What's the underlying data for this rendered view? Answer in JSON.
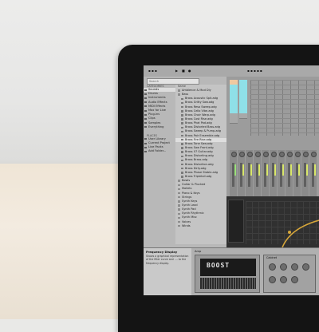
{
  "browser": {
    "search_placeholder": "Search",
    "categories_header": "CATEGORIES",
    "categories": [
      "Sounds",
      "Drums",
      "Instruments",
      "Audio Effects",
      "MIDI Effects",
      "Max for Live",
      "Plug-ins",
      "Clips",
      "Samples",
      "Everything"
    ],
    "places_header": "PLACES",
    "places": [
      "User Library",
      "Current Project",
      "Live Packs",
      "Add Folder..."
    ],
    "files_header": "Name",
    "files": [
      "Ambience & Mod Dly",
      "Bass",
      "Brass Acoustic Spit.adg",
      "Brass Gritty Saw.adg",
      "Brass Reso Sweep.adg",
      "Brass Cello Vibe.adg",
      "Brass Choir Warp.adg",
      "Brass Cost Rise.adg",
      "Brass Phat Pad.adg",
      "Brass Distorted Bass.adg",
      "Brass Sweep & Pump.adg",
      "Brass Pair Ensemble.adg",
      "Brass Fire Rise.adg",
      "Brass Tone Saw.adg",
      "Brass Saw Front.adg",
      "Brass 07 Guitar.adg",
      "Brass Distorting.adg",
      "Brass Brass.adg",
      "Brass Distortion.adg",
      "Brass Dirty.adg",
      "Brass Phase Stable.adg",
      "Brass Tripletail.adg"
    ],
    "folders": [
      "Bowls",
      "Guitar & Plucked",
      "Mallets",
      "Piano & Keys",
      "Strings",
      "Synth Keys",
      "Synth Lead",
      "Synth Pad",
      "Synth Rhythmic",
      "Synth Misc",
      "Voices",
      "Winds"
    ]
  },
  "info": {
    "title": "Frequency Display",
    "text": "Shows a graphical representation of the filter curve and .... to the frequency display."
  },
  "device": {
    "title": "Amp",
    "amp_label": "BOOST",
    "cab_title": "Cabinet"
  }
}
